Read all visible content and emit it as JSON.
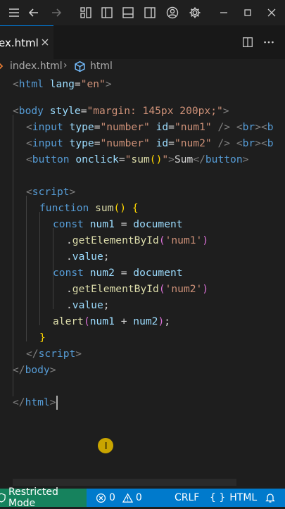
{
  "tab": {
    "label": "ex.html",
    "close": "×"
  },
  "breadcrumb": {
    "file": "index.html",
    "separator": "›",
    "node": "html"
  },
  "code": {
    "l1": {
      "open": "<",
      "tag": "html",
      "attr": "lang",
      "eq": "=",
      "val": "\"en\"",
      "close": ">"
    },
    "l3": {
      "open": "<",
      "tag": "body",
      "attr": "style",
      "eq": "=",
      "val": "\"margin: 145px 200px;\"",
      "close": ">"
    },
    "l4": {
      "tag": "input",
      "a1": "type",
      "v1": "\"number\"",
      "a2": "id",
      "v2": "\"num1\"",
      "end": "/>",
      "br": "br",
      "br2": "b"
    },
    "l5": {
      "tag": "input",
      "a1": "type",
      "v1": "\"number\"",
      "a2": "id",
      "v2": "\"num2\"",
      "end": "/>",
      "br": "br",
      "br2": "b"
    },
    "l6": {
      "tag": "button",
      "a1": "onclick",
      "q1": "\"",
      "fn": "sum",
      "parens": "()",
      "q2": "\"",
      "text": "Sum",
      "closetag": "button"
    },
    "l8": {
      "tag": "script"
    },
    "l9": {
      "kw": "function",
      "fn": "sum",
      "parens": "()",
      "brace": "{"
    },
    "l10": {
      "kw": "const",
      "var": "num1",
      "eq": "=",
      "obj": "document"
    },
    "l11": {
      "dot": ".",
      "fn": "getElementById",
      "po": "(",
      "str": "'num1'",
      "pc": ")"
    },
    "l12": {
      "dot": ".",
      "prop": "value",
      "semi": ";"
    },
    "l13": {
      "kw": "const",
      "var": "num2",
      "eq": "=",
      "obj": "document"
    },
    "l14": {
      "dot": ".",
      "fn": "getElementById",
      "po": "(",
      "str": "'num2'",
      "pc": ")"
    },
    "l15": {
      "dot": ".",
      "prop": "value",
      "semi": ";"
    },
    "l16": {
      "fn": "alert",
      "po": "(",
      "a": "num1",
      "plus": "+",
      "b": "num2",
      "pc": ")",
      "semi": ";"
    },
    "l17": {
      "brace": "}"
    },
    "l18": {
      "tag": "script"
    },
    "l19": {
      "tag": "body"
    },
    "l21": {
      "tag": "html"
    }
  },
  "status": {
    "restricted": "Restricted Mode",
    "errors": "0",
    "warnings": "0",
    "eol": "CRLF",
    "language_braces": "{ }",
    "language": "HTML"
  }
}
